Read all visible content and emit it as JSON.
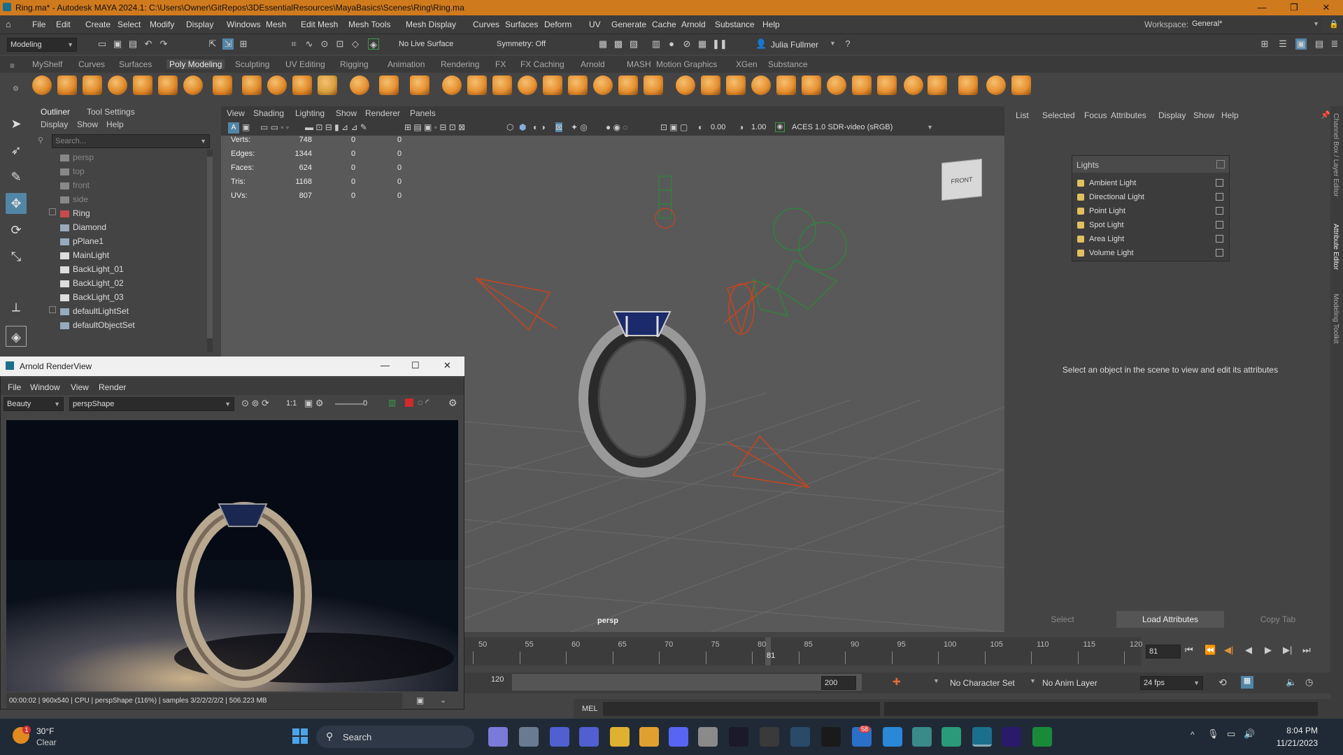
{
  "title": {
    "text": "Ring.ma* - Autodesk MAYA 2024.1: C:\\Users\\Owner\\GitRepos\\3DEssentialResources\\MayaBasics\\Scenes\\Ring\\Ring.ma",
    "minimize": "—",
    "maximize": "❐",
    "close": "✕"
  },
  "menubar": {
    "items": [
      "File",
      "Edit",
      "Create",
      "Select",
      "Modify",
      "Display",
      "Windows",
      "Mesh",
      "Edit Mesh",
      "Mesh Tools",
      "Mesh Display",
      "Curves",
      "Surfaces",
      "Deform",
      "UV",
      "Generate",
      "Cache",
      "Arnold",
      "Substance",
      "Help"
    ],
    "workspace_label": "Workspace:",
    "workspace_value": "General*"
  },
  "statusline": {
    "mode": "Modeling",
    "live_surface": "No Live Surface",
    "symmetry": "Symmetry: Off",
    "user": "Julia Fullmer"
  },
  "shelf": {
    "tabs": [
      "MyShelf",
      "Curves",
      "Surfaces",
      "Poly Modeling",
      "Sculpting",
      "UV Editing",
      "Rigging",
      "Animation",
      "Rendering",
      "FX",
      "FX Caching",
      "Arnold",
      "MASH",
      "Motion Graphics",
      "XGen",
      "Substance"
    ],
    "active": "Poly Modeling"
  },
  "outliner": {
    "tabs": [
      "Outliner",
      "Tool Settings"
    ],
    "menu": [
      "Display",
      "Show",
      "Help"
    ],
    "search_placeholder": "Search...",
    "items": [
      {
        "label": "persp",
        "dim": true
      },
      {
        "label": "top",
        "dim": true
      },
      {
        "label": "front",
        "dim": true
      },
      {
        "label": "side",
        "dim": true
      },
      {
        "label": "Ring"
      },
      {
        "label": "Diamond"
      },
      {
        "label": "pPlane1"
      },
      {
        "label": "MainLight"
      },
      {
        "label": "BackLight_01"
      },
      {
        "label": "BackLight_02"
      },
      {
        "label": "BackLight_03"
      },
      {
        "label": "defaultLightSet"
      },
      {
        "label": "defaultObjectSet"
      }
    ]
  },
  "viewport": {
    "menu": [
      "View",
      "Shading",
      "Lighting",
      "Show",
      "Renderer",
      "Panels"
    ],
    "exposure": "0.00",
    "gamma": "1.00",
    "colorspace": "ACES 1.0 SDR-video (sRGB)",
    "hud": [
      {
        "label": "Verts:",
        "a": "748",
        "b": "0",
        "c": "0"
      },
      {
        "label": "Edges:",
        "a": "1344",
        "b": "0",
        "c": "0"
      },
      {
        "label": "Faces:",
        "a": "624",
        "b": "0",
        "c": "0"
      },
      {
        "label": "Tris:",
        "a": "1168",
        "b": "0",
        "c": "0"
      },
      {
        "label": "UVs:",
        "a": "807",
        "b": "0",
        "c": "0"
      }
    ],
    "camera": "persp",
    "viewcube": "FRONT"
  },
  "attribute_editor": {
    "menu": [
      "List",
      "Selected",
      "Focus",
      "Attributes",
      "Display",
      "Show",
      "Help"
    ],
    "message": "Select an object in the scene to view and edit its attributes",
    "buttons": [
      "Select",
      "Load Attributes",
      "Copy Tab"
    ],
    "side_tabs": [
      "Channel Box / Layer Editor",
      "Attribute Editor",
      "Modeling Toolkit"
    ]
  },
  "lights_panel": {
    "title": "Lights",
    "items": [
      "Ambient Light",
      "Directional Light",
      "Point Light",
      "Spot Light",
      "Area Light",
      "Volume Light"
    ]
  },
  "timeline": {
    "ticks": [
      "50",
      "55",
      "60",
      "65",
      "70",
      "75",
      "80",
      "85",
      "90",
      "95",
      "100",
      "105",
      "110",
      "115",
      "120"
    ],
    "current": "81",
    "current_frame_field": "81"
  },
  "range": {
    "end": "120",
    "max": "200",
    "character_set": "No Character Set",
    "anim_layer": "No Anim Layer",
    "fps": "24 fps"
  },
  "command": {
    "label": "MEL"
  },
  "renderview": {
    "title": "Arnold RenderView",
    "menu": [
      "File",
      "Window",
      "View",
      "Render"
    ],
    "aov": "Beauty",
    "camera": "perspShape",
    "ratio": "1:1",
    "value": "0",
    "status": "00:00:02 | 960x540 | CPU | perspShape (116%) | samples 3/2/2/2/2/2 | 506.223 MB"
  },
  "taskbar": {
    "weather_temp": "30°F",
    "weather_cond": "Clear",
    "weather_badge": "1",
    "search": "Search",
    "notif_badge": "58",
    "time": "8:04 PM",
    "date": "11/21/2023"
  },
  "colors": {
    "accent": "#d07a1e",
    "selected_blue": "#5285a6",
    "light_red": "#c8441c",
    "light_green": "#2a8a3a"
  }
}
